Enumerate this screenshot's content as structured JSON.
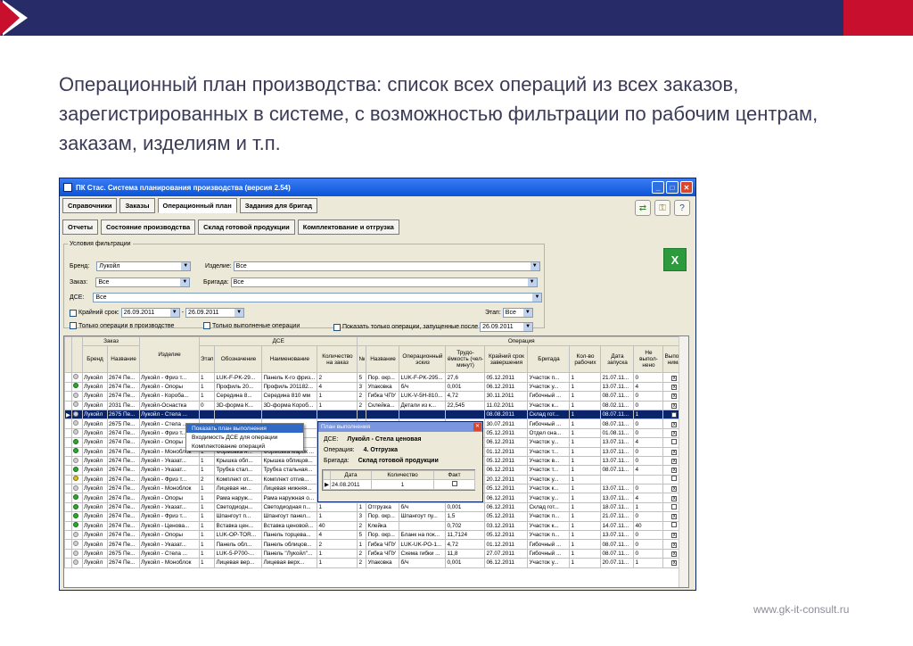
{
  "slide": {
    "title": "Операционный план производства: список всех операций из всех заказов, зарегистрированных в системе, с возможностью фильтрации по рабочим центрам, заказам, изделиям и т.п.",
    "footer": "www.gk-it-consult.ru",
    "brand_colors": {
      "navy": "#272c68",
      "red": "#c8102e"
    }
  },
  "window": {
    "title": "ПК Стас. Система планирования производства (версия 2.54)",
    "controls": {
      "min": "_",
      "max": "□",
      "close": "✕"
    }
  },
  "tabs_row1": [
    {
      "label": "Справочники"
    },
    {
      "label": "Заказы"
    },
    {
      "label": "Операционный план",
      "active": true
    },
    {
      "label": "Задания для бригад"
    }
  ],
  "tabs_row2": [
    {
      "label": "Отчеты"
    },
    {
      "label": "Состояние производства"
    },
    {
      "label": "Склад готовой продукции"
    },
    {
      "label": "Комплектование и отгрузка"
    }
  ],
  "toolbar_icons": [
    "refresh-icon",
    "users-key-icon",
    "help-icon"
  ],
  "filters": {
    "legend": "Условия фильтрации",
    "brand_label": "Бренд:",
    "brand_value": "Лукойл",
    "product_label": "Изделие:",
    "product_value": "Все",
    "order_label": "Заказ:",
    "order_value": "Все",
    "team_label": "Бригада:",
    "team_value": "Все",
    "dse_label": "ДСЕ:",
    "dse_value": "Все",
    "deadline_label": "Крайний срок:",
    "date_from": "26.09.2011",
    "dash": "-",
    "date_to": "26.09.2011",
    "stage_label": "Этап:",
    "stage_value": "Все",
    "only_in_production": "Только операции в производстве",
    "only_completed": "Только выполненые операции",
    "show_started_after": "Показать только операции, запущенные после",
    "started_after_date": "26.09.2011"
  },
  "grid": {
    "group_headers": {
      "order": "Заказ",
      "product": "Изделие",
      "dse": "ДСЕ",
      "operation": "Операция"
    },
    "columns": {
      "brand": "Бренд",
      "name": "Название",
      "stage": "Этап",
      "designation": "Обозначение",
      "naming": "Наименование",
      "qty": "Количество на заказ",
      "num": "№",
      "op_name": "Название",
      "op_sketch": "Операционный эскиз",
      "labor": "Трудо-ёмкость (чел-минут)",
      "deadline": "Крайний срок завершения",
      "team": "Бригада",
      "workers": "Кол-во рабочих",
      "start": "Дата запуска",
      "not_done": "Не выпол-нено",
      "done": "Выпол-нима"
    },
    "rows": [
      [
        "",
        "Лукойл",
        "2674 Пе...",
        "Лукойл - Фриз т...",
        "1",
        "LUK-F-PK-29...",
        "Панель К-го фриз...",
        "2",
        "5",
        "Пор. окр...",
        "LUK-F-PK-295...",
        "27,6",
        "05.12.2011",
        "Участок п...",
        "1",
        "21.07.11...",
        "0",
        "x"
      ],
      [
        "g",
        "Лукойл",
        "2674 Пе...",
        "Лукойл - Опоры",
        "1",
        "Профиль 20...",
        "Профиль 201182...",
        "4",
        "3",
        "Упаковка",
        "б/ч",
        "0,001",
        "06.12.2011",
        "Участок у...",
        "1",
        "13.07.11...",
        "4",
        "x"
      ],
      [
        "",
        "Лукойл",
        "2674 Пе...",
        "Лукойл - Корoба...",
        "1",
        "Середина 8...",
        "Середина 810 мм",
        "1",
        "2",
        "Гибка ЧПУ",
        "LUK-V-5Н-810...",
        "4,72",
        "30.11.2011",
        "Гибочный ...",
        "1",
        "08.07.11...",
        "0",
        "x"
      ],
      [
        "",
        "Лукойл",
        "2031 Пе...",
        "Лукойл-Оснастка",
        "0",
        "3D-форма К...",
        "3D-форма Корoб...",
        "1",
        "2",
        "Склейка...",
        "Детали из к...",
        "22,545",
        "11.02.2011",
        "Участок к...",
        "1",
        "08.02.11...",
        "0",
        "x"
      ],
      [
        "sel",
        "Лукойл",
        "2675 Пе...",
        "Лукойл - Стела ...",
        "",
        "",
        "",
        "",
        "",
        "",
        "",
        "",
        "08.08.2011",
        "Склад гот...",
        "1",
        "08.07.11...",
        "1",
        "x"
      ],
      [
        "",
        "Лукойл",
        "2675 Пе...",
        "Лукойл - Стела ...",
        "",
        "",
        "",
        "",
        "",
        "",
        "",
        "",
        "30.07.2011",
        "Гибочный ...",
        "1",
        "08.07.11...",
        "0",
        "x"
      ],
      [
        "",
        "Лукойл",
        "2674 Пе...",
        "Лукойл - Фриз т...",
        "",
        "",
        "",
        "",
        "",
        "",
        "",
        "",
        "05.12.2011",
        "Отдел сна...",
        "1",
        "01.08.11...",
        "0",
        "x"
      ],
      [
        "g",
        "Лукойл",
        "2674 Пе...",
        "Лукойл - Опоры",
        "",
        "",
        "",
        "",
        "",
        "",
        "",
        "",
        "06.12.2011",
        "Участок у...",
        "1",
        "13.07.11...",
        "4",
        ""
      ],
      [
        "g",
        "Лукойл",
        "2674 Пе...",
        "Лукойл - Моноблок",
        "1",
        "Формовка н...",
        "Формовка марок ...",
        "",
        "",
        "",
        "",
        "",
        "01.12.2011",
        "Участок т...",
        "1",
        "13.07.11...",
        "0",
        "x"
      ],
      [
        "",
        "Лукойл",
        "2674 Пе...",
        "Лукойл - Указат...",
        "1",
        "Крышка обл...",
        "Крышка облицов...",
        "",
        "",
        "",
        "",
        "",
        "05.12.2011",
        "Участок в...",
        "1",
        "13.07.11...",
        "0",
        "x"
      ],
      [
        "g",
        "Лукойл",
        "2674 Пе...",
        "Лукойл - Указат...",
        "1",
        "Трубка стал...",
        "Трубка стальная...",
        "",
        "",
        "",
        "",
        "",
        "06.12.2011",
        "Участок т...",
        "1",
        "08.07.11...",
        "4",
        "x"
      ],
      [
        "o",
        "Лукойл",
        "2674 Пе...",
        "Лукойл - Фриз т...",
        "2",
        "Комплект от...",
        "Комплект отгив...",
        "",
        "",
        "",
        "",
        "",
        "20.12.2011",
        "Участок у...",
        "1",
        "",
        "",
        ""
      ],
      [
        "",
        "Лукойл",
        "2674 Пе...",
        "Лукойл - Моноблок",
        "1",
        "Лицевая ни...",
        "Лицевая нижняя...",
        "",
        "",
        "",
        "",
        "",
        "05.12.2011",
        "Участок к...",
        "1",
        "13.07.11...",
        "0",
        "x"
      ],
      [
        "g",
        "Лукойл",
        "2674 Пе...",
        "Лукойл - Опоры",
        "1",
        "Рама наруж...",
        "Рама наружная о...",
        "4",
        "3",
        "Упаковка",
        "рама наруж...",
        "0,001",
        "06.12.2011",
        "Участок у...",
        "1",
        "13.07.11...",
        "4",
        "x"
      ],
      [
        "g",
        "Лукойл",
        "2674 Пе...",
        "Лукойл - Указат...",
        "1",
        "Светодиодн...",
        "Светодиодная п...",
        "1",
        "1",
        "Отгрузка",
        "б/ч",
        "0,001",
        "06.12.2011",
        "Склад гот...",
        "1",
        "18.07.11...",
        "1",
        ""
      ],
      [
        "g",
        "Лукойл",
        "2674 Пе...",
        "Лукойл - Фриз т...",
        "1",
        "Шпангоут п...",
        "Шпангоут панел...",
        "1",
        "3",
        "Пор. окр...",
        "Шпангоут пу...",
        "1,5",
        "05.12.2011",
        "Участок п...",
        "1",
        "21.07.11...",
        "0",
        "x"
      ],
      [
        "g",
        "Лукойл",
        "2674 Пе...",
        "Лукойл - Ценова...",
        "1",
        "Вставка цен...",
        "Вставка ценовой...",
        "40",
        "2",
        "Клейка",
        "",
        "0,702",
        "03.12.2011",
        "Участок к...",
        "1",
        "14.07.11...",
        "40",
        ""
      ],
      [
        "",
        "Лукойл",
        "2674 Пе...",
        "Лукойл - Опоры",
        "1",
        "LUK-OP-TOR...",
        "Панель торцева...",
        "4",
        "5",
        "Пор. окр...",
        "Бланк на пок...",
        "11,7124",
        "05.12.2011",
        "Участок п...",
        "1",
        "13.07.11...",
        "0",
        "x"
      ],
      [
        "",
        "Лукойл",
        "2674 Пе...",
        "Лукойл - Указат...",
        "1",
        "Панель обл...",
        "Панель облицов...",
        "2",
        "1",
        "Гибка ЧПУ",
        "LUK-UK-PO-1...",
        "4,72",
        "01.12.2011",
        "Гибочный ...",
        "1",
        "08.07.11...",
        "0",
        "x"
      ],
      [
        "",
        "Лукойл",
        "2675 Пе...",
        "Лукойл - Стела ...",
        "1",
        "LUK-5-Р700-...",
        "Панель \"Лукойл\"...",
        "1",
        "2",
        "Гибка ЧПУ",
        "Схема гибки ...",
        "11,8",
        "27.07.2011",
        "Гибочный ...",
        "1",
        "08.07.11...",
        "0",
        "x"
      ],
      [
        "",
        "Лукойл",
        "2674 Пе...",
        "Лукойл - Моноблок",
        "1",
        "Лицевая вер...",
        "Лицевая верх...",
        "1",
        "2",
        "Упаковка",
        "б/ч",
        "0,001",
        "06.12.2011",
        "Участок у...",
        "1",
        "20.07.11...",
        "1",
        "x"
      ]
    ]
  },
  "context_menu": [
    "Показать план выполнения",
    "Входимость ДСЕ для операции",
    "Комплектование операций"
  ],
  "popup": {
    "title": "План выполнения",
    "close": "✕",
    "dse_label": "ДСЕ:",
    "dse_value": "Лукойл - Стела ценовая",
    "op_label": "Операция:",
    "op_value": "4. Отгрузка",
    "team_label": "Бригада:",
    "team_value": "Склад готовой продукции",
    "cols": [
      "Дата",
      "Количество",
      "Факт"
    ],
    "row": [
      "24.08.2011",
      "1",
      ""
    ]
  }
}
